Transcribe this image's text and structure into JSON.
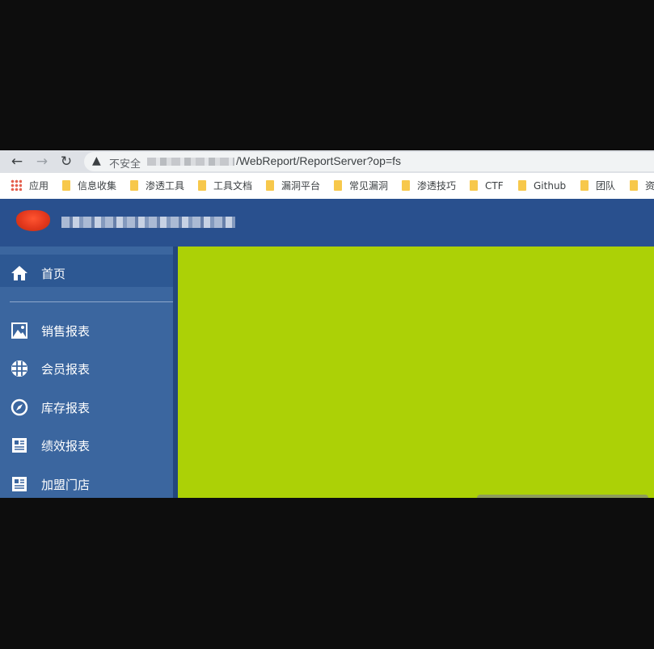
{
  "browser": {
    "security_label": "不安全",
    "url_path": "/WebReport/ReportServer?op=fs",
    "bookmarks": [
      "应用",
      "信息收集",
      "渗透工具",
      "工具文档",
      "漏洞平台",
      "常见漏洞",
      "渗透技巧",
      "CTF",
      "Github",
      "团队",
      "资"
    ]
  },
  "sidebar": {
    "home_label": "首页",
    "items": [
      {
        "label": "销售报表",
        "icon": "image-icon"
      },
      {
        "label": "会员报表",
        "icon": "globe-icon"
      },
      {
        "label": "库存报表",
        "icon": "compass-icon"
      },
      {
        "label": "绩效报表",
        "icon": "document-icon"
      },
      {
        "label": "加盟门店",
        "icon": "document-icon"
      }
    ]
  },
  "colors": {
    "header": "#29508e",
    "sidebar": "#3b669f",
    "content": "#acd106"
  }
}
